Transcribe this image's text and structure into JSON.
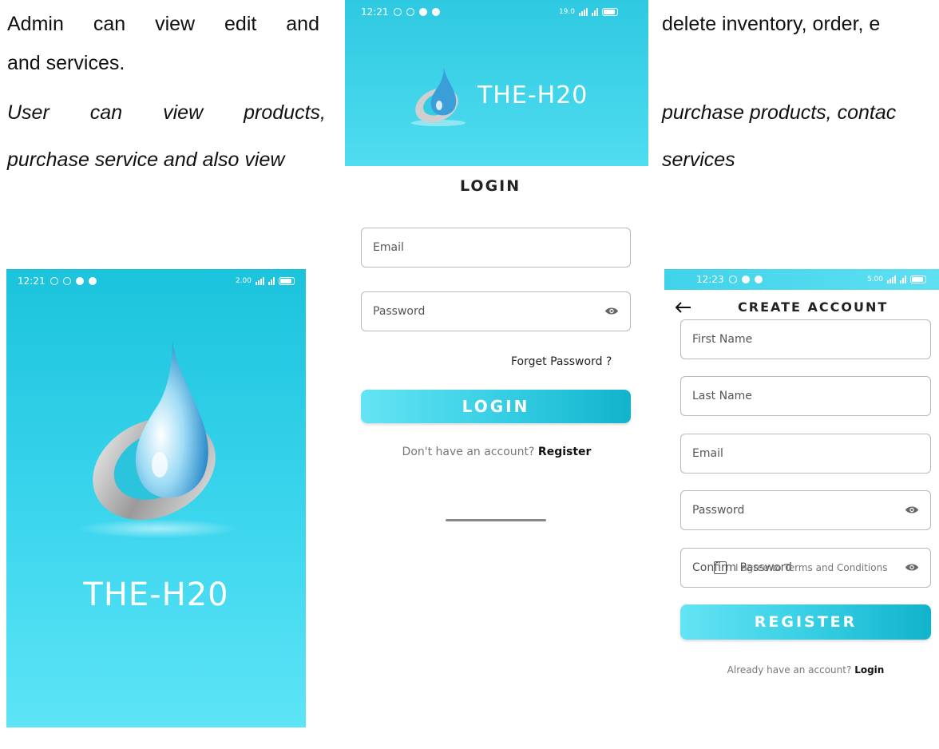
{
  "doc": {
    "admin_left": [
      "Admin",
      "can",
      "view",
      "edit",
      "and"
    ],
    "admin_right": "delete inventory, order, e",
    "admin_line2": "and services.",
    "user_left": [
      "User",
      "can",
      "view",
      "products,"
    ],
    "user_right": "purchase products, contac",
    "user_line2": "purchase service and also view",
    "user_line2_right": "services"
  },
  "splash": {
    "status_time": "12:21",
    "status_net": "2.00",
    "brand": "THE-H20"
  },
  "login": {
    "status_time": "12:21",
    "status_net": "19.0",
    "brand": "THE-H20",
    "title": "LOGIN",
    "email_placeholder": "Email",
    "password_placeholder": "Password",
    "forgot_label": "Forget Password ?",
    "login_button": "LOGIN",
    "no_account_text": "Don't have an account?",
    "register_link": "Register"
  },
  "register": {
    "status_time": "12:23",
    "status_net": "5.00",
    "title": "CREATE ACCOUNT",
    "first_name_placeholder": "First Name",
    "last_name_placeholder": "Last Name",
    "email_placeholder": "Email",
    "password_placeholder": "Password",
    "confirm_password_placeholder": "Confirm Password",
    "terms_label": "I agree to Terms and Conditions",
    "register_button": "REGISTER",
    "have_account_text": "Already have an account?",
    "login_link": "Login"
  },
  "colors": {
    "accent": "#34cde3",
    "splash_top": "#1bc3dc",
    "splash_bottom": "#5de4f6"
  }
}
